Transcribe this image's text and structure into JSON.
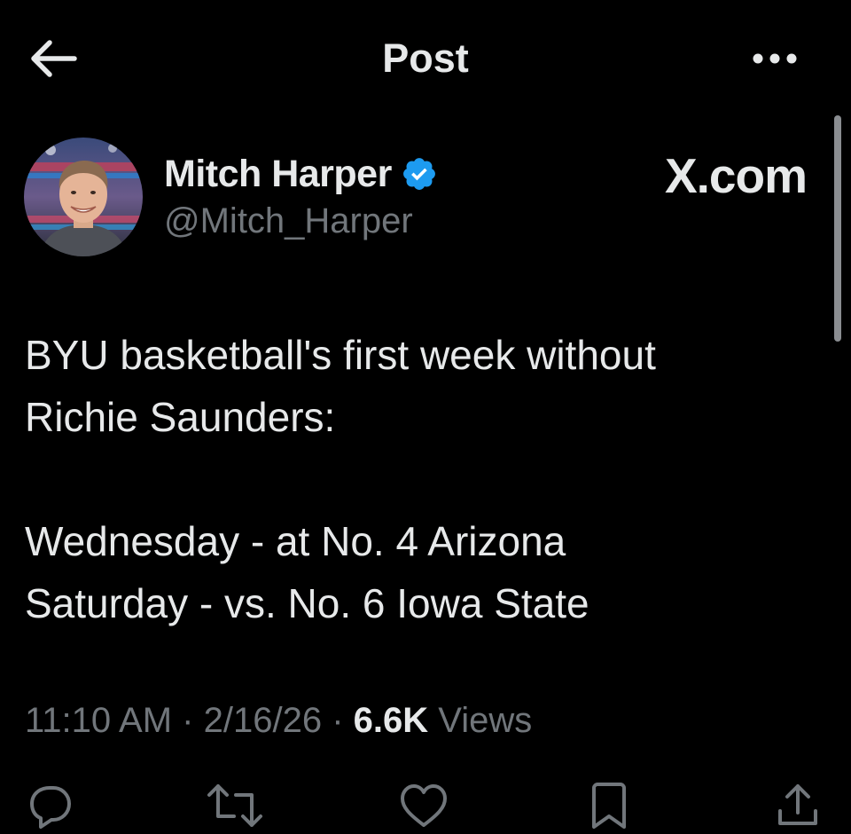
{
  "header": {
    "title": "Post",
    "back_icon": "arrow-left-icon",
    "more_icon": "more-horizontal-icon"
  },
  "author": {
    "name": "Mitch Harper",
    "handle": "@Mitch_Harper",
    "verified": true,
    "verified_color": "#1d9bf0"
  },
  "watermark": "X.com",
  "post": {
    "lines": [
      "BYU basketball's first week without",
      "Richie Saunders:",
      "",
      "Wednesday - at No. 4 Arizona",
      "Saturday - vs. No. 6 Iowa State"
    ]
  },
  "meta": {
    "time": "11:10 AM",
    "date": "2/16/26",
    "views_count": "6.6K",
    "views_label": "Views"
  },
  "actions": [
    {
      "name": "reply",
      "icon": "reply-icon"
    },
    {
      "name": "repost",
      "icon": "repost-icon"
    },
    {
      "name": "like",
      "icon": "heart-icon"
    },
    {
      "name": "bookmark",
      "icon": "bookmark-icon"
    },
    {
      "name": "share",
      "icon": "share-icon"
    }
  ],
  "colors": {
    "background": "#000000",
    "text_primary": "#e7e9ea",
    "text_secondary": "#71767b",
    "accent": "#1d9bf0"
  }
}
